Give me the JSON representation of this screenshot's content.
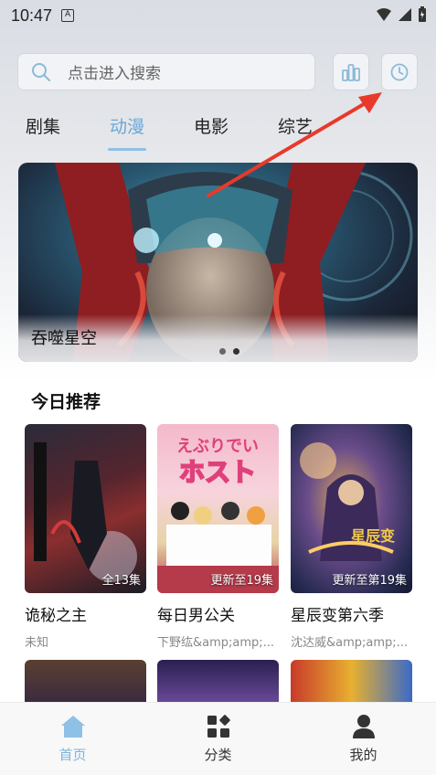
{
  "status_bar": {
    "time": "10:47",
    "badge": "A"
  },
  "search": {
    "placeholder": "点击进入搜索"
  },
  "tabs": [
    {
      "label": "剧集",
      "active": false
    },
    {
      "label": "动漫",
      "active": true
    },
    {
      "label": "电影",
      "active": false
    },
    {
      "label": "综艺",
      "active": false
    }
  ],
  "banner": {
    "title": "吞噬星空"
  },
  "section": {
    "title": "今日推荐"
  },
  "cards": [
    {
      "title": "诡秘之主",
      "subtitle": "未知",
      "badge": "全13集"
    },
    {
      "title": "每日男公关",
      "subtitle": "下野纮&amp;amp;...",
      "badge": "更新至19集"
    },
    {
      "title": "星辰变第六季",
      "subtitle": "沈达威&amp;amp;...",
      "badge": "更新至第19集"
    }
  ],
  "bottom_nav": [
    {
      "label": "首页",
      "icon": "home-icon",
      "active": true
    },
    {
      "label": "分类",
      "icon": "category-icon",
      "active": false
    },
    {
      "label": "我的",
      "icon": "profile-icon",
      "active": false
    }
  ],
  "colors": {
    "accent": "#7ab4dc",
    "tab_active": "#6aa7d6",
    "arrow": "#e8392b"
  }
}
